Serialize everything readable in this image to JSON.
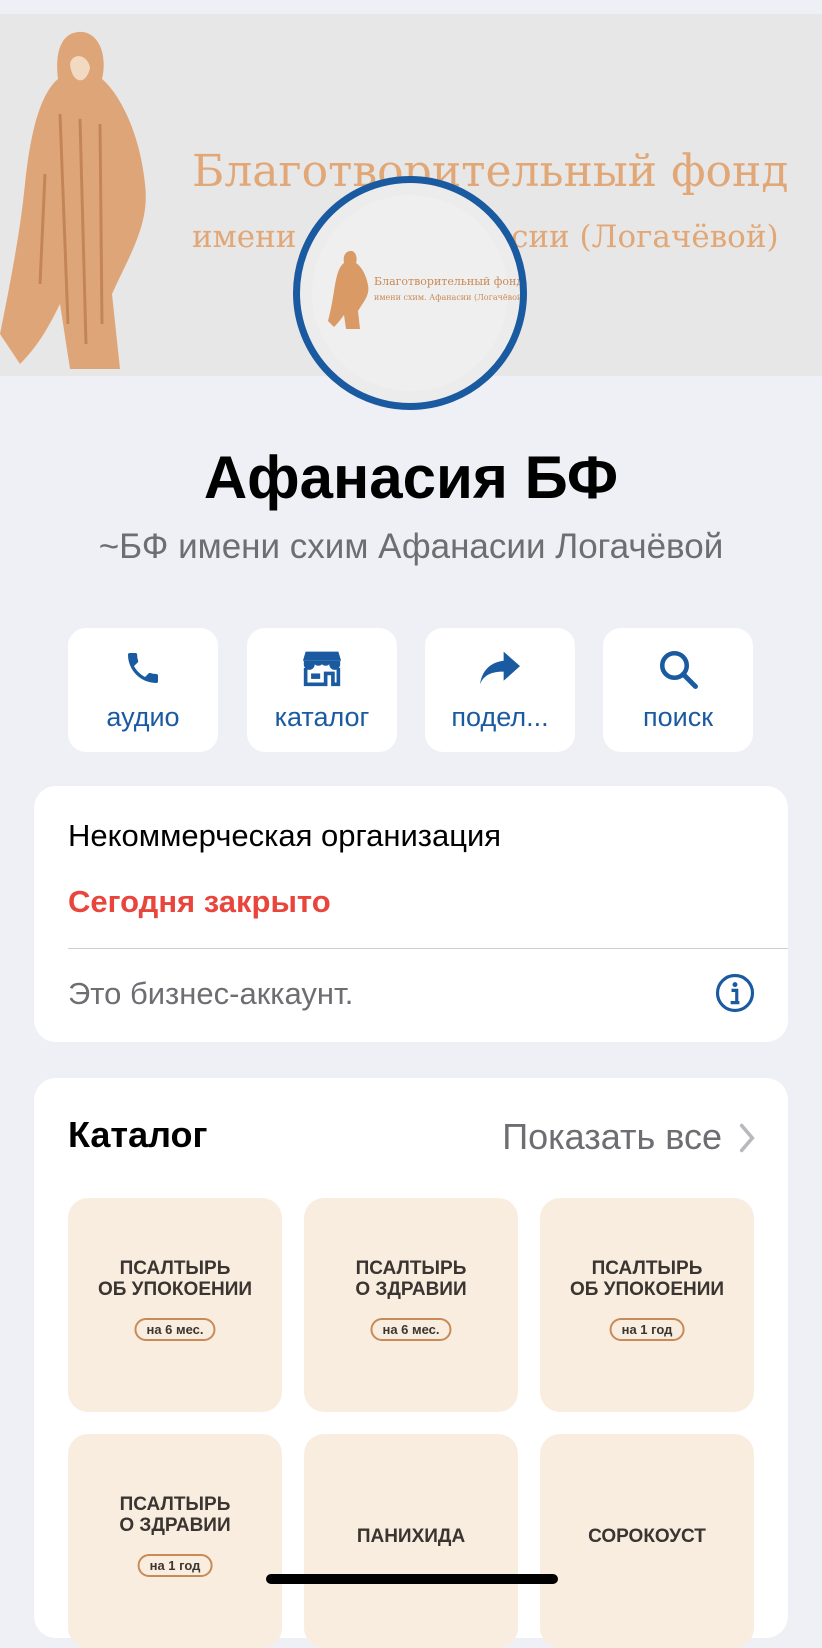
{
  "cover": {
    "line1": "Благотворительный фонд",
    "line2": "имени схим. Афанасии (Логачёвой)",
    "accent": "#e1a777"
  },
  "avatar": {
    "line1": "Благотворительный фонд",
    "line2": "имени схим. Афанасии (Логачёвой)",
    "ring_color": "#1a5aa0"
  },
  "profile": {
    "name": "Афанасия БФ",
    "subtitle": "~БФ имени схим Афанасии Логачёвой"
  },
  "actions": [
    {
      "label": "аудио",
      "icon": "phone-icon"
    },
    {
      "label": "каталог",
      "icon": "storefront-icon"
    },
    {
      "label": "подел...",
      "icon": "share-arrow-icon"
    },
    {
      "label": "поиск",
      "icon": "search-icon"
    }
  ],
  "info": {
    "category": "Некоммерческая организация",
    "status": "Сегодня закрыто",
    "note": "Это бизнес-аккаунт.",
    "status_color": "#e8463d",
    "icon": "info-circle-icon"
  },
  "catalog": {
    "title": "Каталог",
    "show_all": "Показать все",
    "items": [
      {
        "title": "ПСАЛТЫРЬ\nОБ УПОКОЕНИИ",
        "badge": "на 6 мес."
      },
      {
        "title": "ПСАЛТЫРЬ\nО ЗДРАВИИ",
        "badge": "на 6 мес."
      },
      {
        "title": "ПСАЛТЫРЬ\nОБ УПОКОЕНИИ",
        "badge": "на 1 год"
      },
      {
        "title": "ПСАЛТЫРЬ\nО ЗДРАВИИ",
        "badge": "на 1 год"
      },
      {
        "title": "ПАНИХИДА",
        "badge": ""
      },
      {
        "title": "СОРОКОУСТ",
        "badge": ""
      }
    ]
  },
  "accent_color": "#1a5aa0"
}
